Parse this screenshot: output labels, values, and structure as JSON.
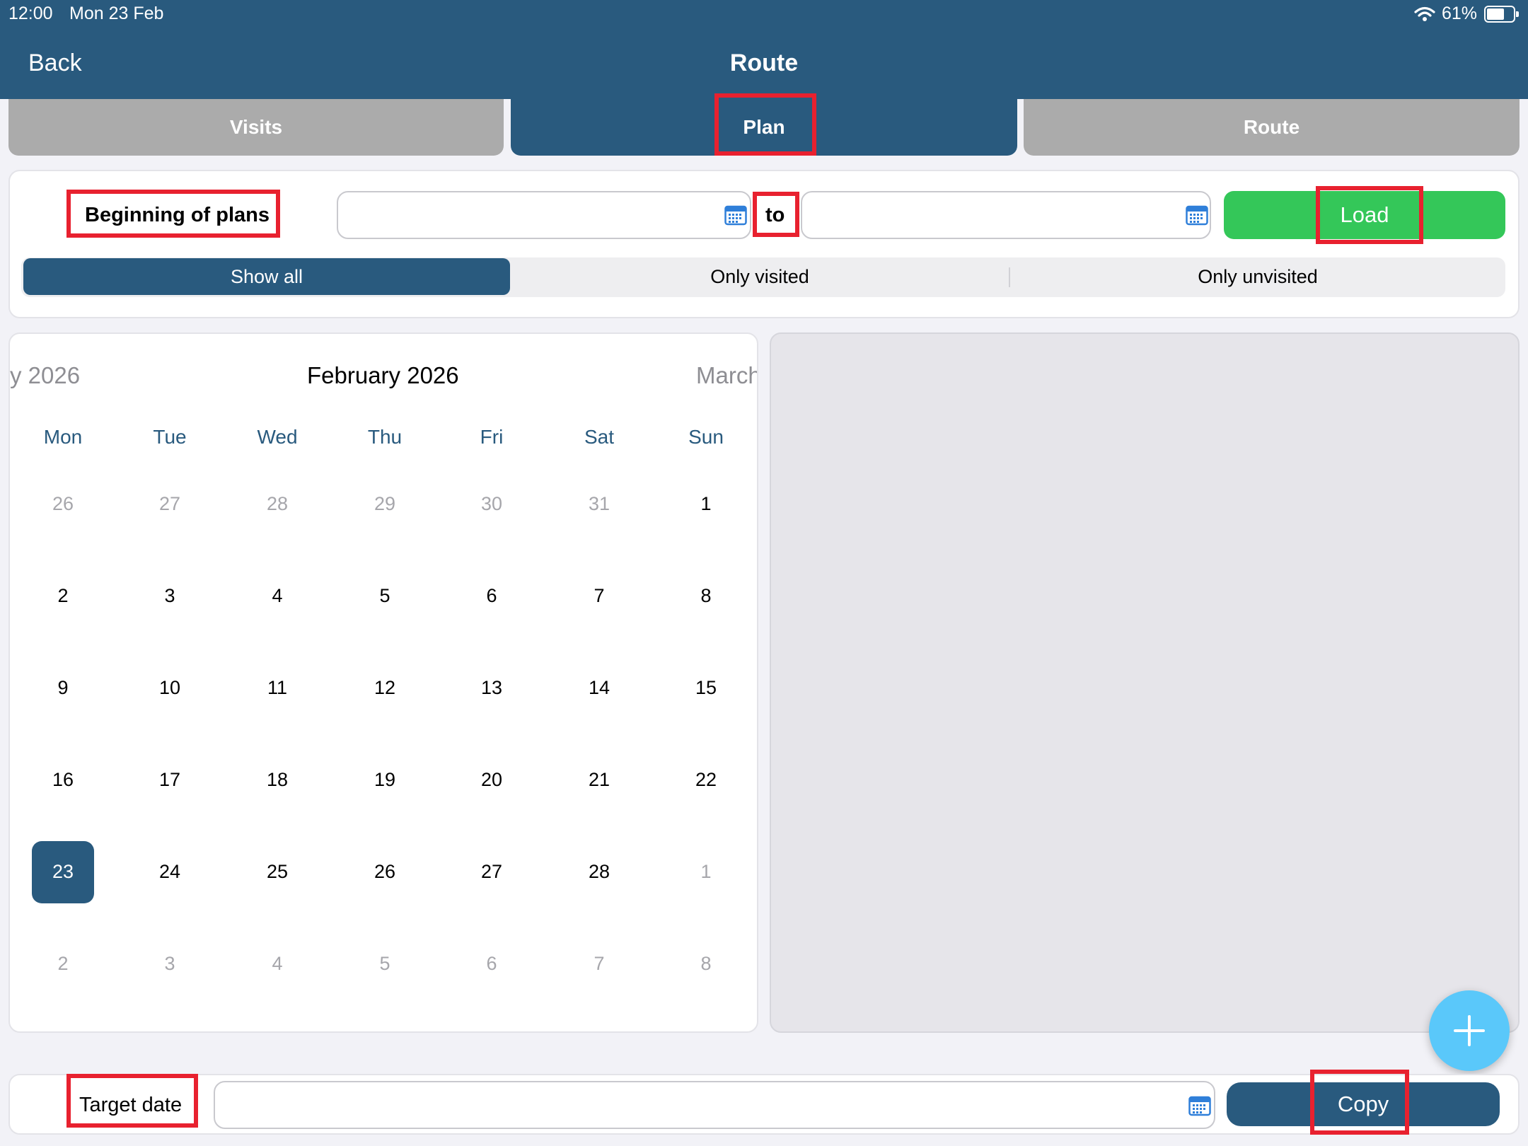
{
  "status": {
    "time": "12:00",
    "date": "Mon 23 Feb",
    "battery": "61%",
    "battery_level": 0.61
  },
  "nav": {
    "back_label": "Back",
    "title": "Route"
  },
  "tabs": [
    {
      "label": "Visits",
      "selected": false
    },
    {
      "label": "Plan",
      "selected": true
    },
    {
      "label": "Route",
      "selected": false
    }
  ],
  "plan_range": {
    "label": "Beginning of plans",
    "from_value": "",
    "separator": "to",
    "to_value": "",
    "load_label": "Load"
  },
  "filters": [
    {
      "label": "Show all",
      "selected": true
    },
    {
      "label": "Only visited",
      "selected": false
    },
    {
      "label": "Only unvisited",
      "selected": false
    }
  ],
  "calendar": {
    "prev_month": "y 2026",
    "current_month": "February 2026",
    "next_month": "March",
    "weekdays": [
      "Mon",
      "Tue",
      "Wed",
      "Thu",
      "Fri",
      "Sat",
      "Sun"
    ],
    "weeks": [
      [
        "26",
        "27",
        "28",
        "29",
        "30",
        "31",
        "1"
      ],
      [
        "2",
        "3",
        "4",
        "5",
        "6",
        "7",
        "8"
      ],
      [
        "9",
        "10",
        "11",
        "12",
        "13",
        "14",
        "15"
      ],
      [
        "16",
        "17",
        "18",
        "19",
        "20",
        "21",
        "22"
      ],
      [
        "23",
        "24",
        "25",
        "26",
        "27",
        "28",
        "1"
      ],
      [
        "2",
        "3",
        "4",
        "5",
        "6",
        "7",
        "8"
      ]
    ],
    "selected_day": "23"
  },
  "copy": {
    "label": "Target date",
    "value": "",
    "button_label": "Copy"
  },
  "colors": {
    "primary": "#295a7e",
    "green": "#34c759",
    "gray_tab": "#ababab",
    "fab": "#5ac8fa",
    "highlight": "#e8212f"
  },
  "icons": {
    "fab": "plus-icon",
    "date_picker": "calendar-icon"
  }
}
